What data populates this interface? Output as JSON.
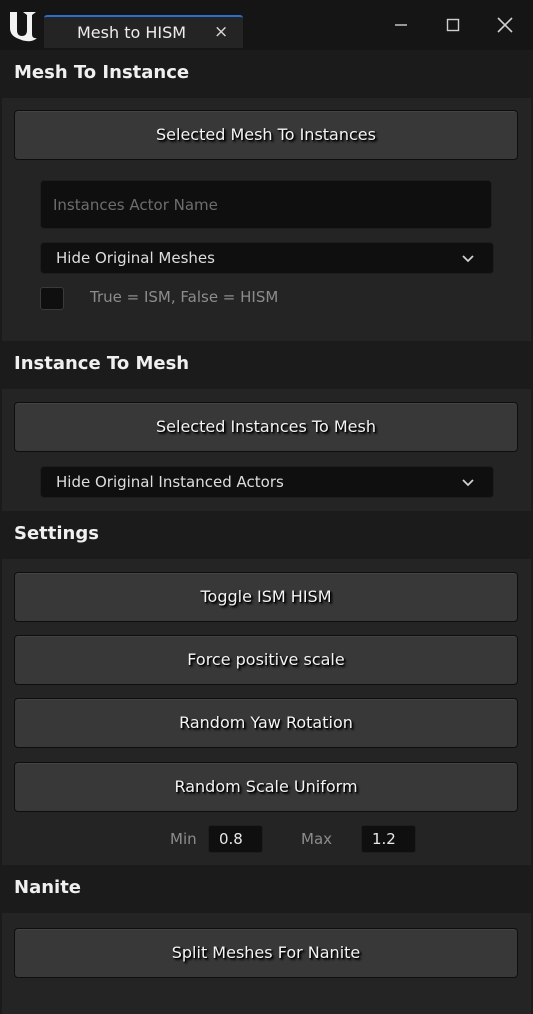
{
  "window": {
    "tab_title": "Mesh to HISM",
    "tab_close": "×",
    "icons": {
      "logo": "unreal-logo-icon",
      "close_tab": "close-icon",
      "minimize": "minimize-icon",
      "maximize": "maximize-icon",
      "close_window": "close-icon"
    }
  },
  "mesh_to_instance": {
    "title": "Mesh To Instance",
    "convert_button": "Selected Mesh To Instances",
    "actor_name_placeholder": "Instances Actor Name",
    "actor_name_value": "",
    "hide_dropdown_selected": "Hide Original Meshes",
    "ism_checkbox_checked": false,
    "ism_checkbox_label": "True = ISM, False = HISM"
  },
  "instance_to_mesh": {
    "title": "Instance To Mesh",
    "convert_button": "Selected Instances To Mesh",
    "hide_dropdown_selected": "Hide Original Instanced Actors"
  },
  "settings": {
    "title": "Settings",
    "toggle_button": "Toggle ISM HISM",
    "force_scale_button": "Force positive scale",
    "random_yaw_button": "Random Yaw Rotation",
    "random_scale_button": "Random Scale Uniform",
    "min_label": "Min",
    "min_value": "0.8",
    "max_label": "Max",
    "max_value": "1.2"
  },
  "nanite": {
    "title": "Nanite",
    "split_button": "Split Meshes For Nanite"
  },
  "colors": {
    "accent": "#2b6fc7",
    "panel": "#242424",
    "header": "#1b1b1b",
    "button": "#383838",
    "field": "#0f0f0f"
  }
}
